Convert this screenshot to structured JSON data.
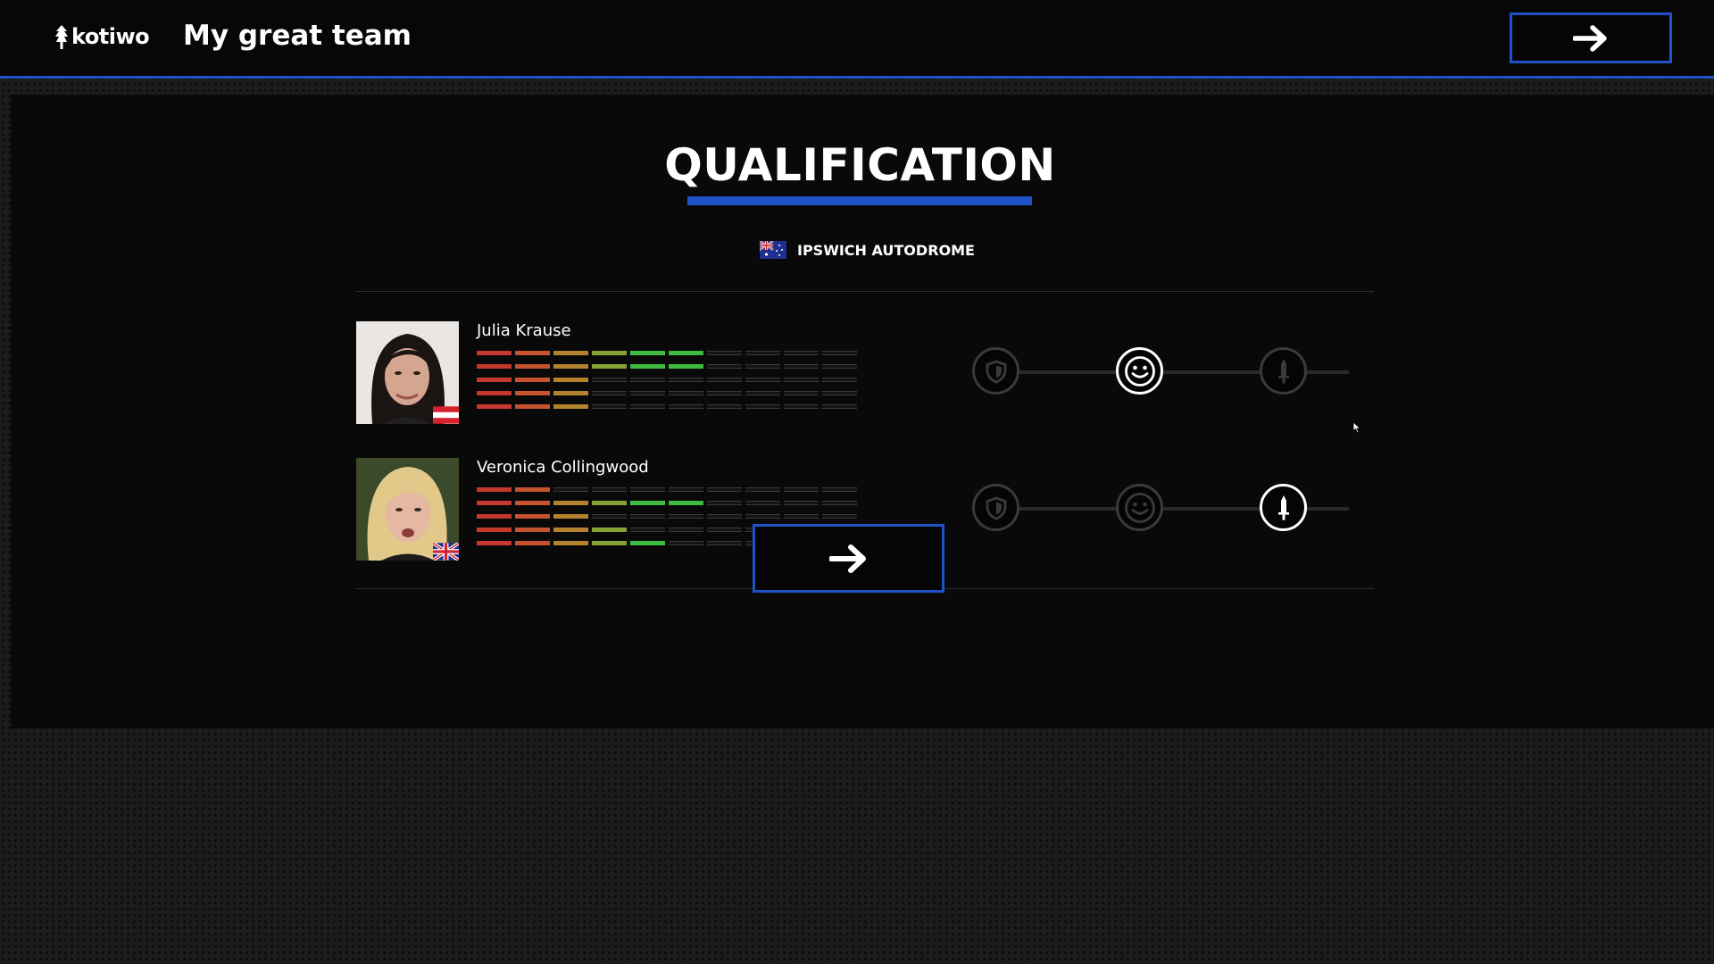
{
  "header": {
    "logo_text": "kotiwo",
    "team_name": "My great team",
    "next_icon": "arrow-right-icon"
  },
  "page": {
    "title": "QUALIFICATION",
    "track": {
      "name": "IPSWICH AUTODROME",
      "flag": "australia-flag-icon"
    },
    "next_icon": "arrow-right-icon"
  },
  "drivers": [
    {
      "name": "Julia Krause",
      "nationality_flag": "austria-flag-icon",
      "skill_levels": [
        6,
        6,
        3,
        3,
        3
      ],
      "selected_mode": "neutral"
    },
    {
      "name": "Veronica Collingwood",
      "nationality_flag": "uk-flag-icon",
      "skill_levels": [
        2,
        6,
        3,
        4,
        5
      ],
      "selected_mode": "attack"
    }
  ],
  "modes": [
    "defensive",
    "neutral",
    "attack"
  ],
  "mode_icons": [
    "shield-icon",
    "smiley-icon",
    "sword-icon"
  ],
  "colors": {
    "accent": "#1f52c7",
    "skill_gradient": [
      "#c6382e",
      "#c5532f",
      "#b3822e",
      "#85a334",
      "#3fbb3f",
      "#3fbb3f"
    ]
  }
}
